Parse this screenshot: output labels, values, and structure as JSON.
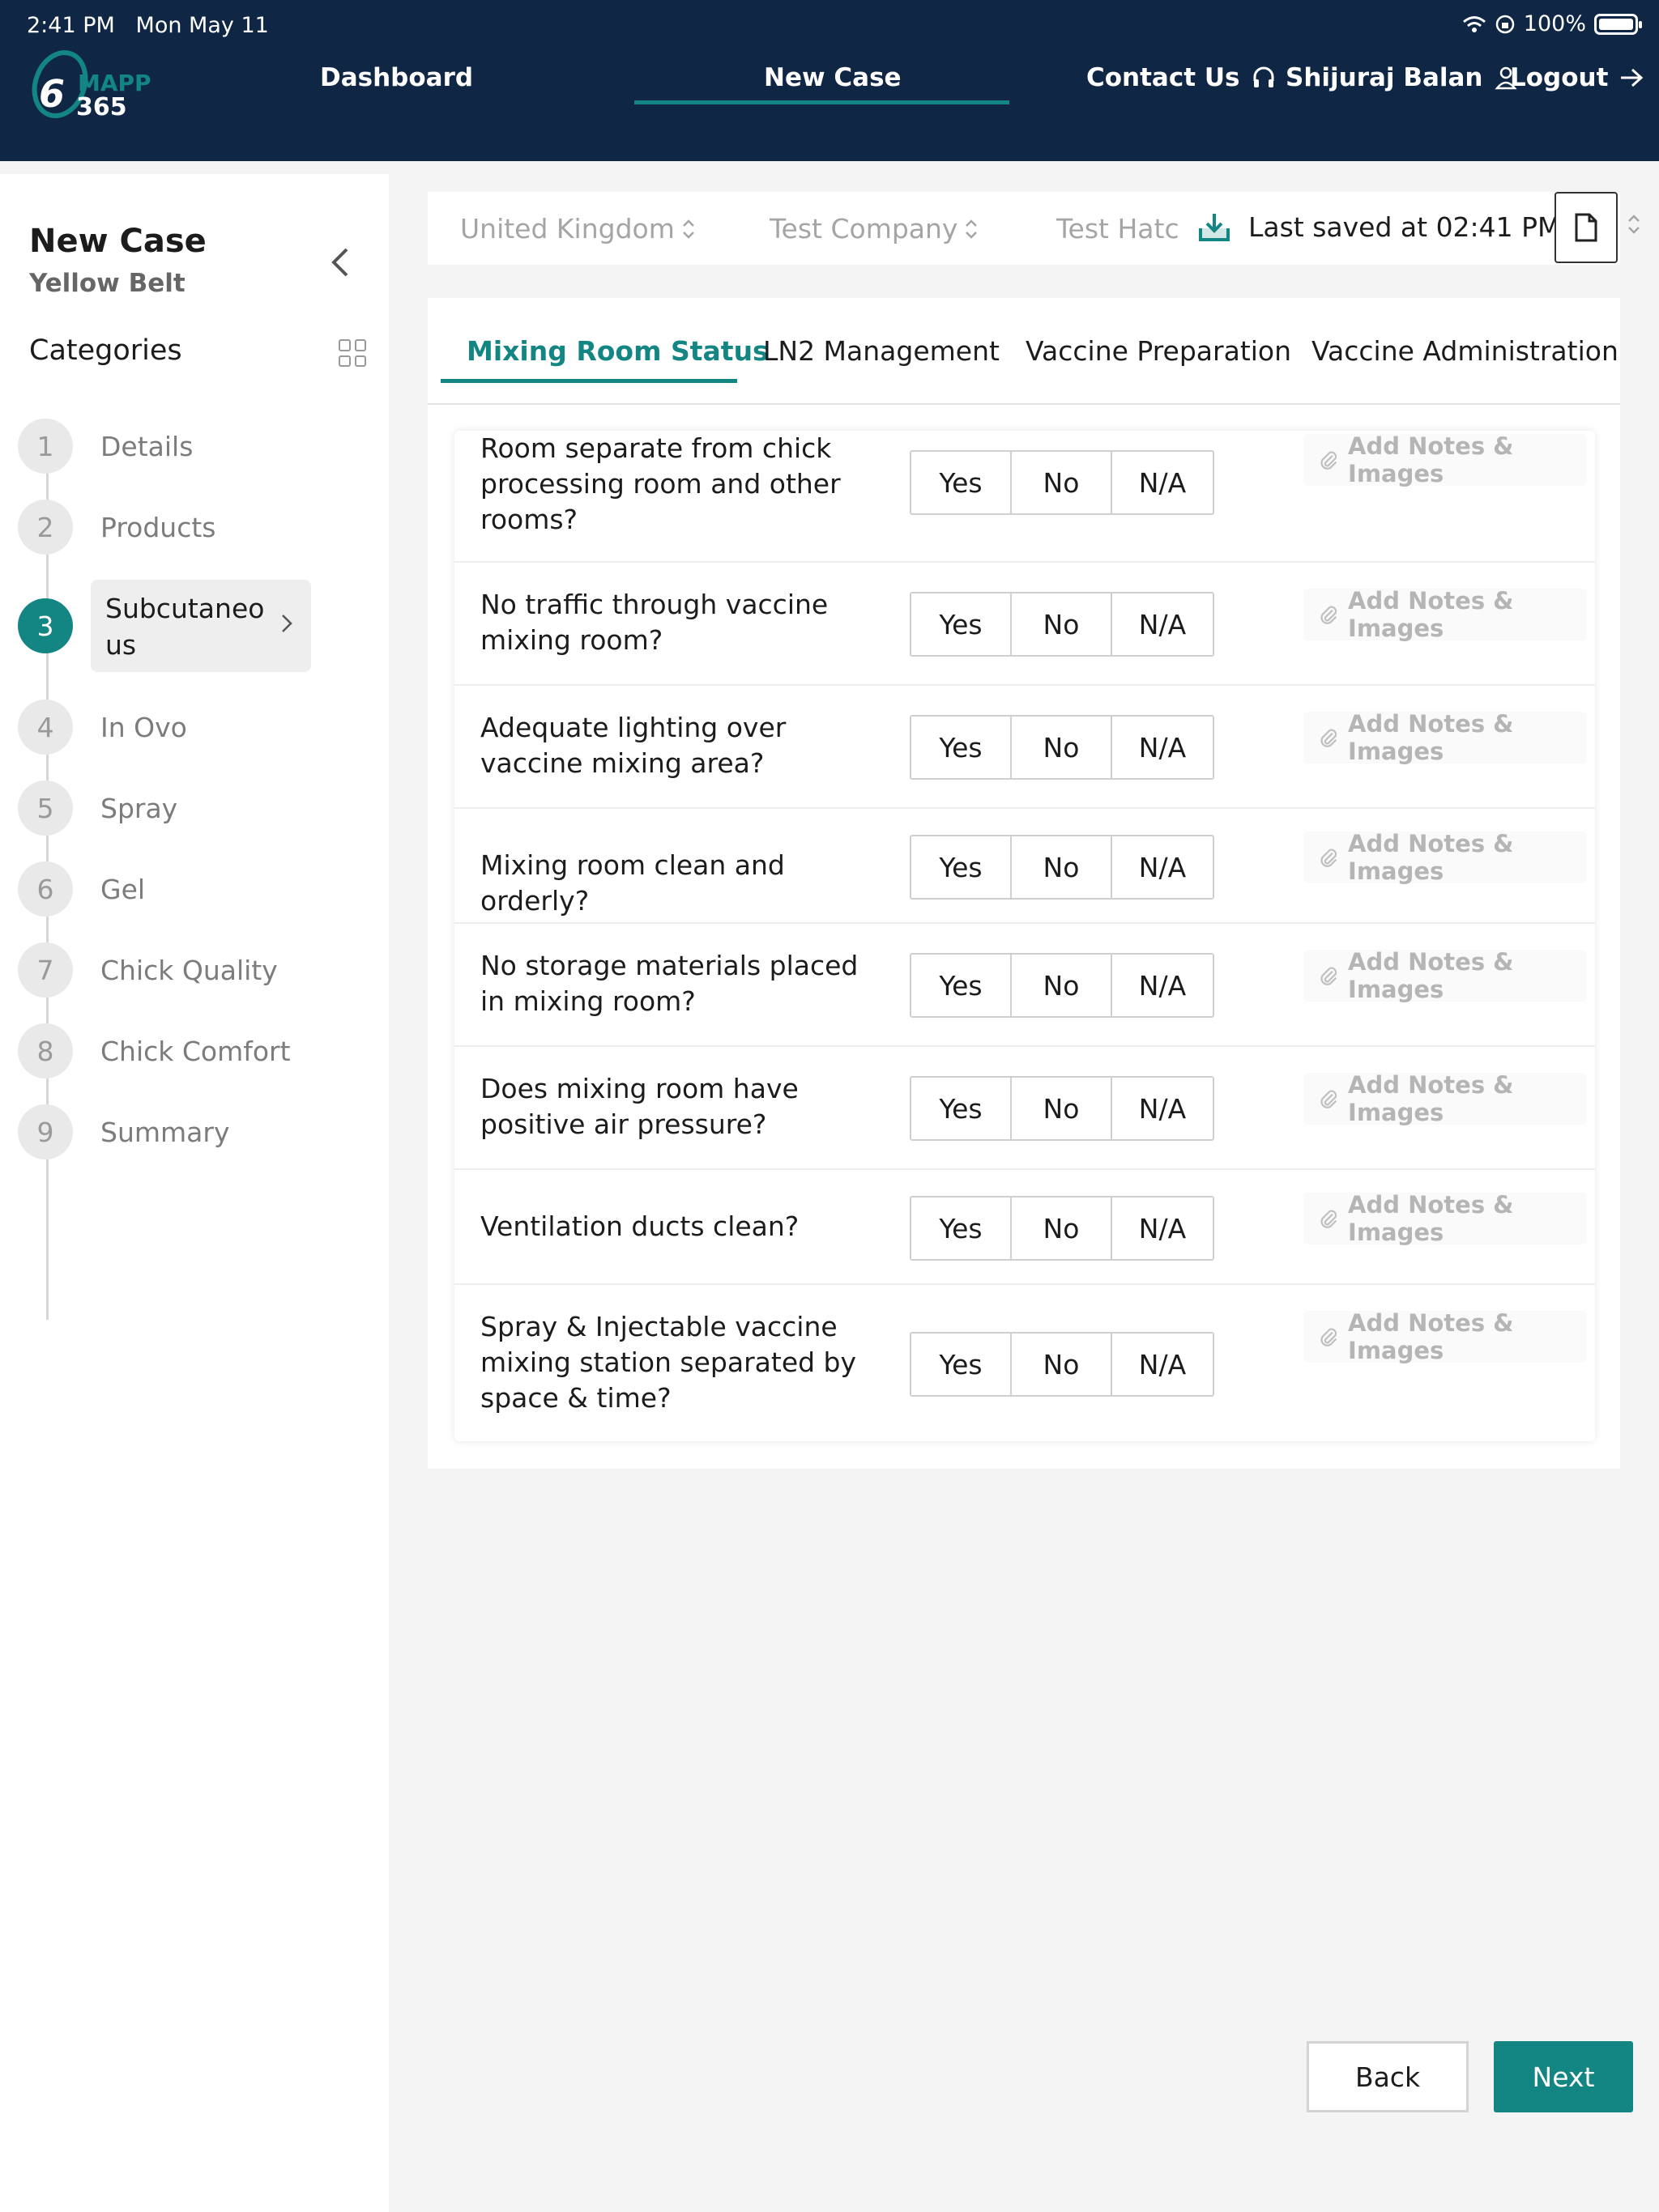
{
  "status_bar": {
    "time": "2:41 PM",
    "date": "Mon May 11",
    "battery": "100%"
  },
  "header": {
    "logo_text_top": "MAPP",
    "logo_text_bottom": "365",
    "nav": {
      "dashboard": "Dashboard",
      "new_case": "New Case",
      "contact": "Contact Us",
      "user": "Shijuraj Balan",
      "logout": "Logout"
    },
    "accent_color": "#138683",
    "background_color": "#0f2745"
  },
  "sidebar": {
    "title": "New Case",
    "subtitle": "Yellow Belt",
    "categories_label": "Categories",
    "steps": [
      {
        "num": "1",
        "label": "Details"
      },
      {
        "num": "2",
        "label": "Products"
      },
      {
        "num": "3",
        "label": "Subcutaneous"
      },
      {
        "num": "4",
        "label": "In Ovo"
      },
      {
        "num": "5",
        "label": "Spray"
      },
      {
        "num": "6",
        "label": "Gel"
      },
      {
        "num": "7",
        "label": "Chick Quality"
      },
      {
        "num": "8",
        "label": "Chick Comfort"
      },
      {
        "num": "9",
        "label": "Summary"
      }
    ],
    "active_step": "3"
  },
  "filter_bar": {
    "country": "United Kingdom",
    "company": "Test Company",
    "hatchery": "Test Hatc",
    "last_saved": "Last saved at 02:41 PM",
    "extra": "1"
  },
  "tabs": [
    {
      "label": "Mixing Room Status",
      "active": true
    },
    {
      "label": "LN2 Management",
      "active": false
    },
    {
      "label": "Vaccine Preparation",
      "active": false
    },
    {
      "label": "Vaccine Administration",
      "active": false
    }
  ],
  "options": {
    "yes": "Yes",
    "no": "No",
    "na": "N/A"
  },
  "notes_label": "Add Notes & Images",
  "questions": [
    "Room separate from chick processing room and other rooms?",
    "No traffic through vaccine mixing room?",
    "Adequate lighting over vaccine mixing area?",
    "Mixing room clean and orderly?",
    "No storage materials placed in mixing room?",
    "Does mixing room have positive air pressure?",
    "Ventilation ducts clean?",
    "Spray & Injectable vaccine mixing station separated by space & time?"
  ],
  "footer": {
    "back": "Back",
    "next": "Next"
  }
}
